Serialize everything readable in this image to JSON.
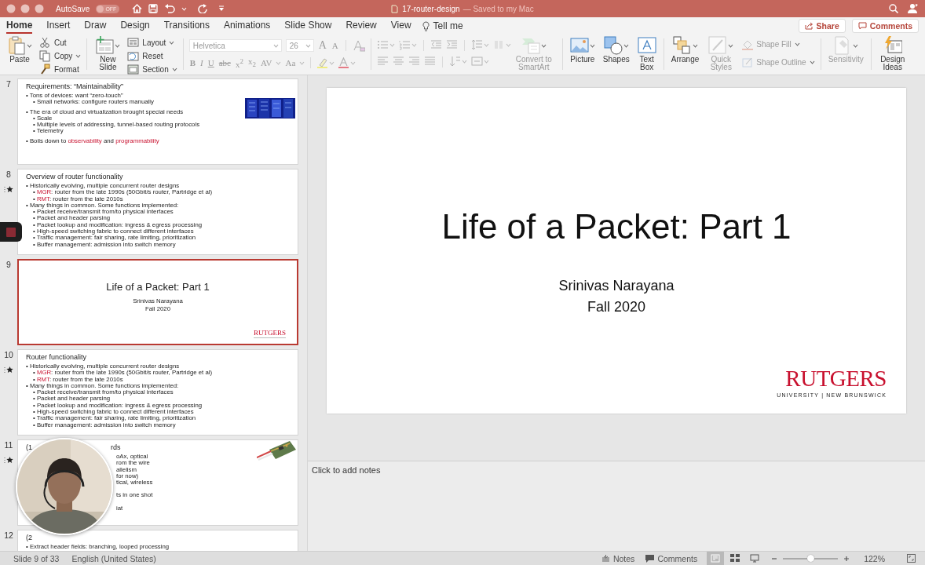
{
  "window": {
    "title": "17-router-design",
    "status": "— Saved to my Mac",
    "autosave": {
      "label": "AutoSave",
      "toggle": "OFF",
      "on": false
    }
  },
  "tabs": [
    {
      "label": "Home",
      "selected": true
    },
    {
      "label": "Insert",
      "selected": false
    },
    {
      "label": "Draw",
      "selected": false
    },
    {
      "label": "Design",
      "selected": false
    },
    {
      "label": "Transitions",
      "selected": false
    },
    {
      "label": "Animations",
      "selected": false
    },
    {
      "label": "Slide Show",
      "selected": false
    },
    {
      "label": "Review",
      "selected": false
    },
    {
      "label": "View",
      "selected": false
    }
  ],
  "tell_me": "Tell me",
  "share_button": "Share",
  "comments_button": "Comments",
  "ribbon": {
    "paste": "Paste",
    "clipboard": [
      {
        "label": "Cut",
        "menu": false
      },
      {
        "label": "Copy",
        "menu": true
      },
      {
        "label": "Format",
        "menu": false
      }
    ],
    "new_slide": "New Slide",
    "slides": [
      {
        "label": "Layout",
        "menu": true
      },
      {
        "label": "Reset",
        "menu": false
      },
      {
        "label": "Section",
        "menu": true
      }
    ],
    "font": {
      "value": "Helvetica",
      "disabled": true
    },
    "font_size": {
      "value": "26",
      "disabled": true
    },
    "size_glyphs": [
      "A",
      "A"
    ],
    "format_glyphs": [
      "B",
      "I",
      "U",
      "abc",
      "x$^{2}$",
      "x$_{2}$",
      "AV",
      "Aa"
    ],
    "convert_smartart": {
      "label": "Convert to SmartArt",
      "disabled": true
    },
    "insert": [
      {
        "label": "Picture",
        "menu": true
      },
      {
        "label": "Shapes",
        "menu": true
      },
      {
        "label": "Text Box",
        "menu": false
      }
    ],
    "arrange": {
      "label": "Arrange",
      "menu": true
    },
    "quick_styles": {
      "label": "Quick Styles",
      "disabled": true
    },
    "shape_format": [
      {
        "label": "Shape Fill",
        "disabled": true
      },
      {
        "label": "Shape Outline",
        "disabled": true
      }
    ],
    "sensitivity": {
      "label": "Sensitivity",
      "disabled": true
    },
    "design_ideas": "Design Ideas"
  },
  "slides": [
    {
      "number": "7",
      "kind": "content",
      "selected": false,
      "animated": false,
      "title": "Requirements: “Maintainability”",
      "picture": true,
      "blocks": [
        {
          "lines": [
            {
              "text": "• Tons of devices: want “zero-touch”",
              "children": [
                {
                  "text": "• Small networks: configure routers manually"
                }
              ]
            }
          ]
        },
        {
          "lines": [
            {
              "text": "• The era of cloud and virtualization brought special needs",
              "children": [
                {
                  "text": "• Scale"
                },
                {
                  "text": "• Multiple levels of addressing, tunnel-based routing protocols"
                },
                {
                  "text": "• Telemetry"
                }
              ]
            }
          ]
        },
        {
          "lines": [
            {
              "parts": [
                {
                  "text": "• Boils down to ",
                  "accent": false
                },
                {
                  "text": "observability",
                  "accent": true
                },
                {
                  "text": " and ",
                  "accent": false
                },
                {
                  "text": "programmability",
                  "accent": true
                }
              ]
            }
          ]
        }
      ]
    },
    {
      "number": "8",
      "kind": "content",
      "selected": false,
      "animated": true,
      "title": "Overview of router functionality",
      "picture": false,
      "blocks": [
        {
          "lines": [
            {
              "text": "• Historically evolving, multiple concurrent router designs",
              "children": [
                {
                  "parts": [
                    {
                      "text": "• ",
                      "accent": false
                    },
                    {
                      "text": "MGR",
                      "accent": true
                    },
                    {
                      "text": ": router from the late 1990s (50Gbit/s router, Partridge et al)",
                      "accent": false
                    }
                  ]
                },
                {
                  "parts": [
                    {
                      "text": "• ",
                      "accent": false
                    },
                    {
                      "text": "RMT",
                      "accent": true
                    },
                    {
                      "text": ": router from the late 2010s",
                      "accent": false
                    }
                  ]
                }
              ]
            },
            {
              "text": "• Many things in common. Some functions implemented:",
              "children": [
                {
                  "text": "• Packet receive/transmit from/to physical interfaces"
                },
                {
                  "text": "• Packet and header parsing"
                },
                {
                  "text": "• Packet lookup and modification: ingress & egress processing"
                },
                {
                  "text": "• High-speed switching fabric to connect different interfaces"
                },
                {
                  "text": "• Traffic management: fair sharing, rate limiting, prioritization"
                },
                {
                  "text": "• Buffer management: admission into switch memory"
                }
              ]
            }
          ]
        }
      ]
    },
    {
      "number": "9",
      "kind": "title",
      "selected": true,
      "animated": false,
      "title": "Life of a Packet: Part 1",
      "picture": false,
      "blocks": [
        {
          "lines": [
            {
              "text": "Srinivas Narayana"
            },
            {
              "text": "Fall 2020"
            }
          ]
        }
      ],
      "logo": "RUTGERS"
    },
    {
      "number": "10",
      "kind": "content",
      "selected": false,
      "animated": true,
      "title": "Router functionality",
      "picture": false,
      "blocks": [
        {
          "lines": [
            {
              "text": "• Historically evolving, multiple concurrent router designs",
              "children": [
                {
                  "parts": [
                    {
                      "text": "• ",
                      "accent": false
                    },
                    {
                      "text": "MGR",
                      "accent": true
                    },
                    {
                      "text": ": router from the late 1990s (50Gbit/s router, Partridge et al)",
                      "accent": false
                    }
                  ]
                },
                {
                  "parts": [
                    {
                      "text": "• ",
                      "accent": false
                    },
                    {
                      "text": "RMT",
                      "accent": true
                    },
                    {
                      "text": ": router from the late 2010s",
                      "accent": false
                    }
                  ]
                }
              ]
            },
            {
              "text": "• Many things in common. Some functions implemented:",
              "children": [
                {
                  "text": "• Packet receive/transmit from/to physical interfaces"
                },
                {
                  "text": "• Packet and header parsing"
                },
                {
                  "text": "• Packet lookup and modification: ingress & egress processing"
                },
                {
                  "text": "• High-speed switching fabric to connect different interfaces"
                },
                {
                  "text": "• Traffic management: fair sharing, rate limiting, prioritization"
                },
                {
                  "text": "• Buffer management: admission into switch memory"
                }
              ]
            }
          ]
        }
      ]
    },
    {
      "number": "11",
      "kind": "covered",
      "selected": false,
      "animated": true,
      "title_fragments": [
        "(1",
        "rds"
      ],
      "picture": true,
      "blocks": [
        {
          "lines": [
            {
              "text": "oAx, optical"
            },
            {
              "text": "rom the wire"
            },
            {
              "text": "allelism"
            },
            {
              "text": "for now)"
            },
            {
              "text": "tical, wireless"
            }
          ]
        },
        {
          "lines": [
            {
              "text": "ts in one shot"
            }
          ]
        },
        {
          "lines": [
            {
              "text": "iat"
            }
          ]
        }
      ]
    },
    {
      "number": "12",
      "kind": "content",
      "selected": false,
      "animated": false,
      "title": "(2",
      "picture": false,
      "blocks": [
        {
          "lines": [
            {
              "text": "• Extract header fields: branching, looped processing"
            }
          ]
        }
      ]
    }
  ],
  "current_slide": {
    "title": "Life of a Packet: Part 1",
    "lines": [
      "Srinivas Narayana",
      "Fall 2020"
    ],
    "logo": {
      "wordmark": "RUTGERS",
      "tagline": "UNIVERSITY | NEW BRUNSWICK"
    }
  },
  "notes": {
    "placeholder": "Click to add notes"
  },
  "status_bar": {
    "slide": "Slide 9 of 33",
    "language": "English (United States)",
    "notes": "Notes",
    "comments": "Comments",
    "views": [
      {
        "selected": true
      },
      {
        "selected": false
      },
      {
        "selected": false
      }
    ],
    "zoom": {
      "level": 0.5,
      "reading": "122%"
    }
  }
}
